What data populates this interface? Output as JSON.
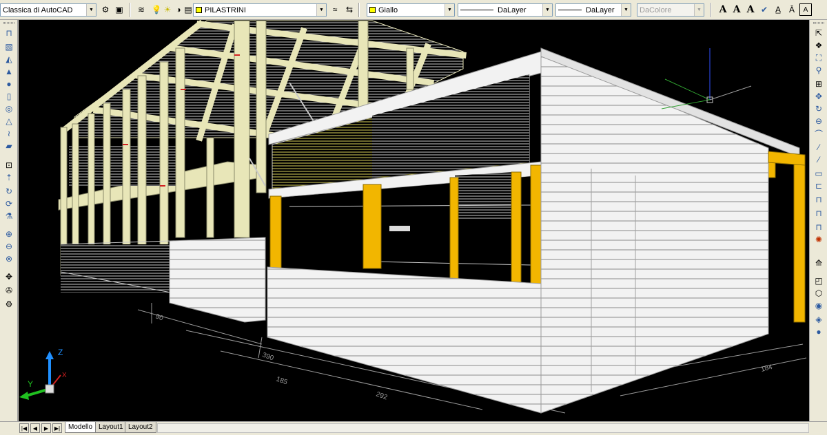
{
  "toolbar": {
    "workspace": "Classica di AutoCAD",
    "layer": "PILASTRINI",
    "color": "Giallo",
    "color_swatch": "#ffff00",
    "linetype": "DaLayer",
    "lineweight": "DaLayer",
    "plotstyle": "DaColore",
    "text_icons": [
      "A",
      "A",
      "A"
    ]
  },
  "tabs": [
    "Modello",
    "Layout1",
    "Layout2"
  ],
  "nav_buttons": [
    "first-icon",
    "prev-icon",
    "next-icon",
    "last-icon"
  ],
  "ucs": {
    "x": "X",
    "y": "Y",
    "z": "Z"
  },
  "colors": {
    "viewport_bg": "#000000",
    "frame_beams": "#e8e6b8",
    "yellow_columns": "#f2b600",
    "cladding": "#f0f0f0"
  }
}
